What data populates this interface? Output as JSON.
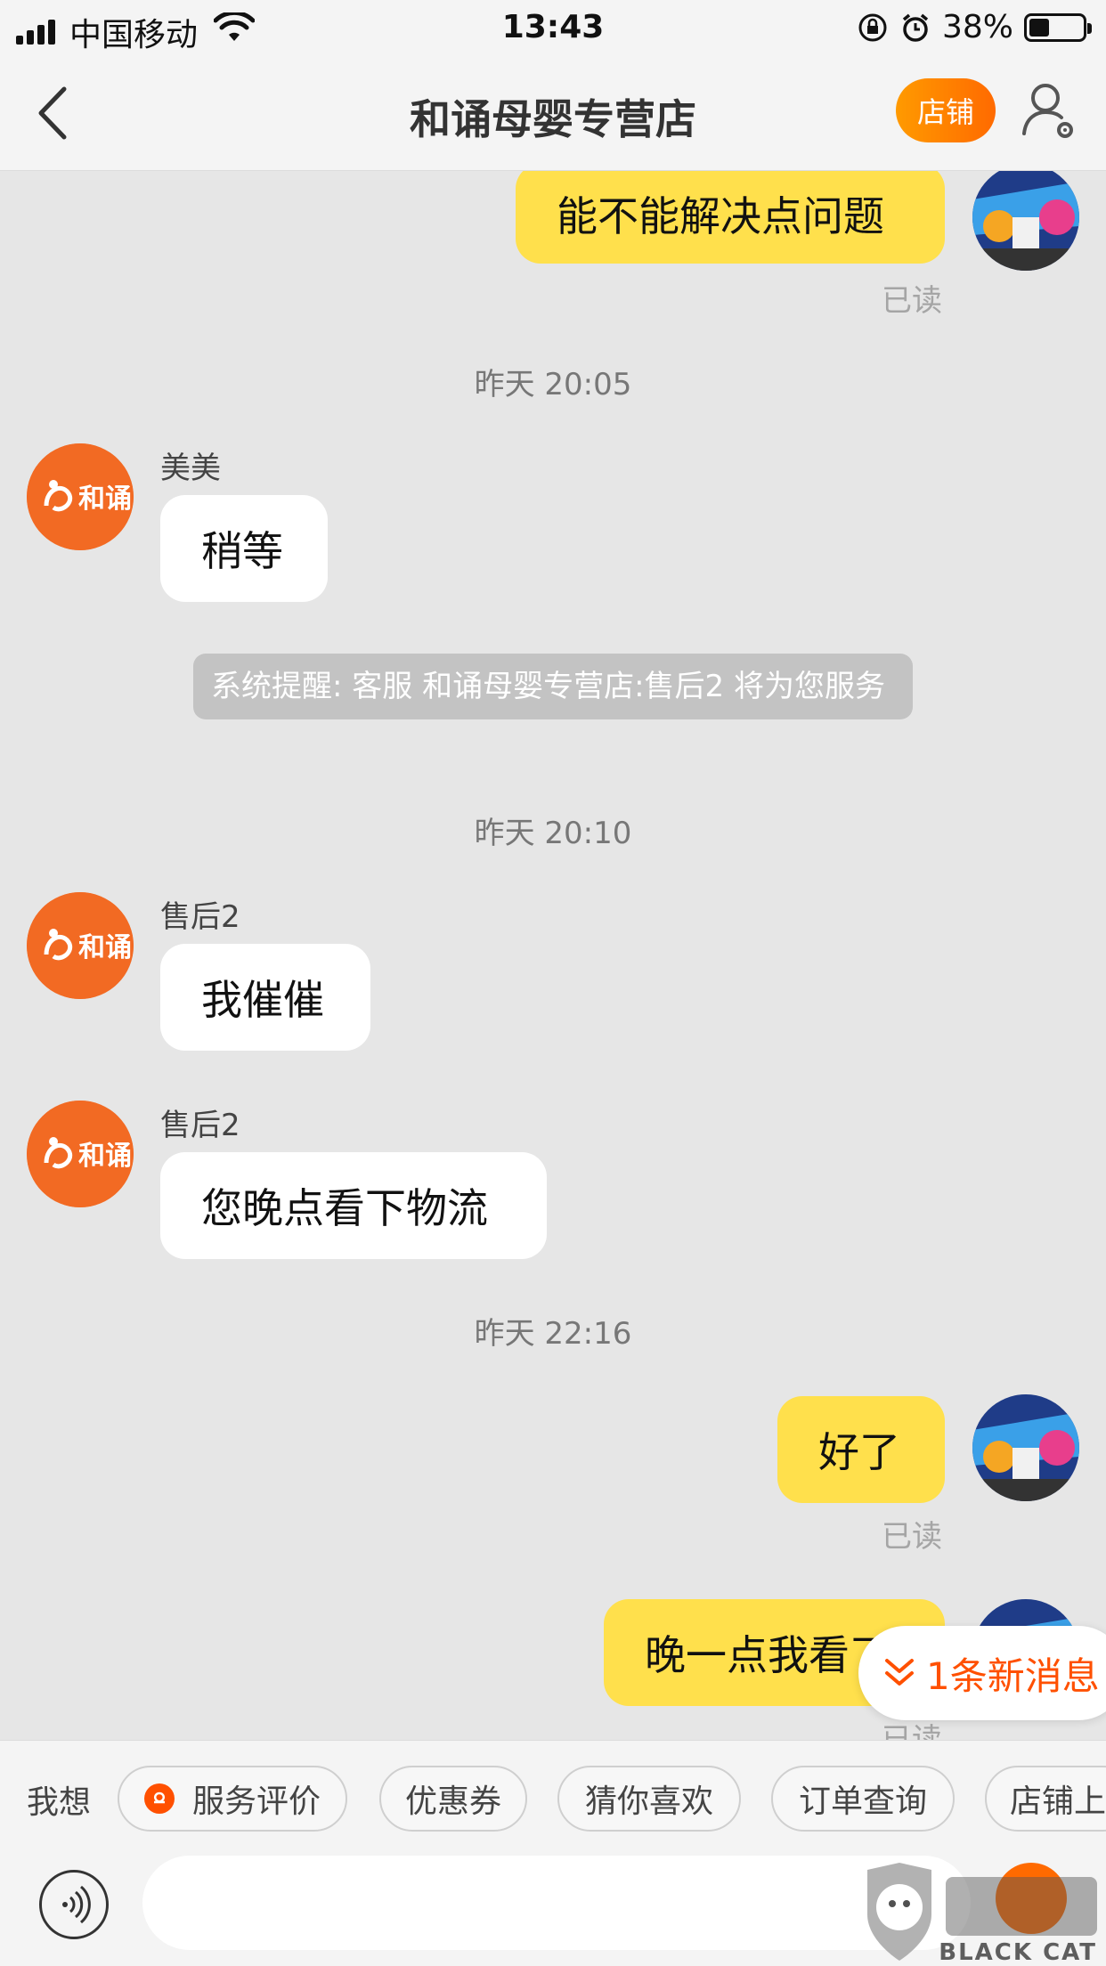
{
  "status_bar": {
    "carrier": "中国移动",
    "time": "13:43",
    "battery": "38%"
  },
  "nav": {
    "title": "和诵母婴专营店",
    "shop_button": "店铺"
  },
  "shop_avatar_text": "和诵",
  "messages": [
    {
      "side": "me",
      "text": "能不能解决点问题",
      "read": "已读"
    },
    {
      "timestamp": "昨天 20:05"
    },
    {
      "side": "them",
      "sender": "美美",
      "text": "稍等"
    },
    {
      "system": "系统提醒: 客服 和诵母婴专营店:售后2 将为您服务"
    },
    {
      "timestamp": "昨天 20:10"
    },
    {
      "side": "them",
      "sender": "售后2",
      "text": "我催催"
    },
    {
      "side": "them",
      "sender": "售后2",
      "text": "您晚点看下物流"
    },
    {
      "timestamp": "昨天 22:16"
    },
    {
      "side": "me",
      "text": "好了",
      "read": "已读"
    },
    {
      "side": "me",
      "text": "晚一点我看了",
      "read": "已读"
    }
  ],
  "new_message_pill": "1条新消息",
  "quick_bar": {
    "label": "我想",
    "chips": [
      "服务评价",
      "优惠券",
      "猜你喜欢",
      "订单查询",
      "店铺上新"
    ]
  },
  "watermark": "BLACK CAT",
  "colors": {
    "accent": "#ff5000",
    "my_bubble": "#ffe04c",
    "shop_avatar": "#f26a23"
  }
}
